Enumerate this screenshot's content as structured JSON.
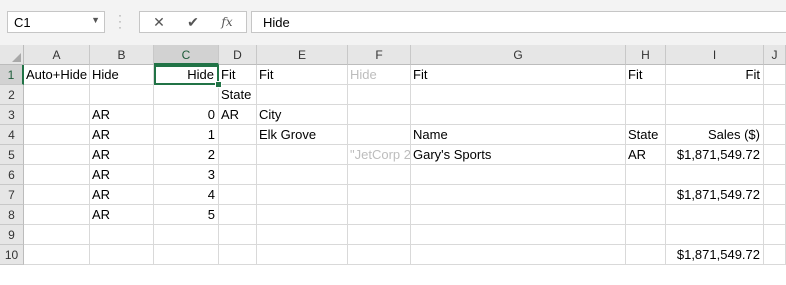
{
  "name_box": {
    "value": "C1"
  },
  "formula_bar": {
    "cancel_icon": "✕",
    "enter_icon": "✔",
    "fx_label": "fx",
    "value": "Hide"
  },
  "columns": [
    "A",
    "B",
    "C",
    "D",
    "E",
    "F",
    "G",
    "H",
    "I",
    "J"
  ],
  "rows": [
    "1",
    "2",
    "3",
    "4",
    "5",
    "6",
    "7",
    "8",
    "9",
    "10"
  ],
  "selected": {
    "column": "C",
    "row": "1",
    "cell": "C1"
  },
  "cells": {
    "A1": "Auto+Hide",
    "B1": "Hide",
    "C1": "Hide",
    "D1": "Fit",
    "E1": "Fit",
    "F1": "Hide",
    "G1": "Fit",
    "H1": "Fit",
    "I1": "Fit",
    "D2": "State",
    "B3": "AR",
    "C3": "0",
    "D3": "AR",
    "E3": "City",
    "B4": "AR",
    "C4": "1",
    "E4": "Elk Grove",
    "G4": "Name",
    "H4": "State",
    "I4": "Sales ($)",
    "B5": "AR",
    "C5": "2",
    "F5": "\"JetCorp 2",
    "G5": "Gary's Sports",
    "H5": "AR",
    "I5": "$1,871,549.72",
    "B6": "AR",
    "C6": "3",
    "B7": "AR",
    "C7": "4",
    "I7": "$1,871,549.72",
    "B8": "AR",
    "C8": "5",
    "I10": "$1,871,549.72"
  },
  "colors": {
    "accent": "#217346",
    "hidden_text": "#bdbdbd"
  }
}
